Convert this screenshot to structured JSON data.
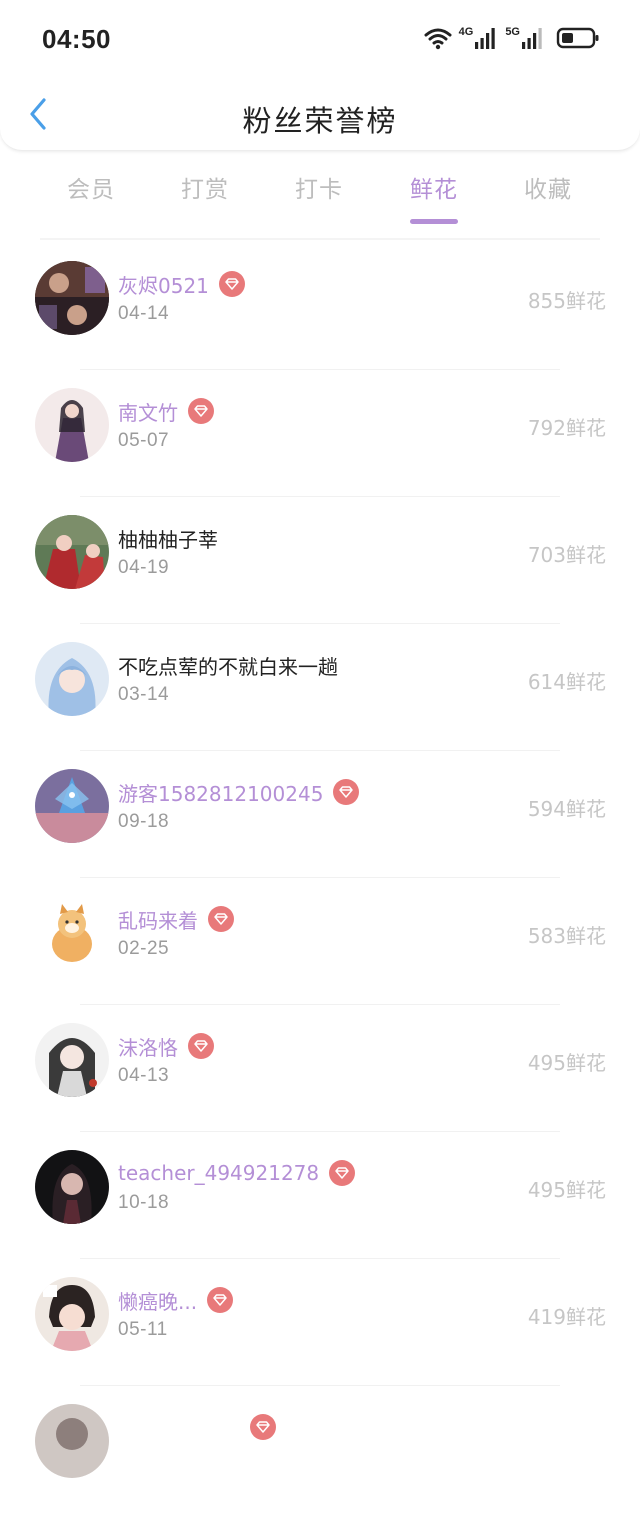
{
  "status_bar": {
    "time": "04:50",
    "wifi_icon": "wifi-icon",
    "sim1_label": "4G",
    "sim2_label": "5G",
    "battery_icon": "battery-icon"
  },
  "header": {
    "back_icon": "chevron-left-icon",
    "title": "粉丝荣誉榜"
  },
  "tabs": [
    {
      "label": "会员"
    },
    {
      "label": "打赏"
    },
    {
      "label": "打卡"
    },
    {
      "label": "鲜花"
    },
    {
      "label": "收藏"
    }
  ],
  "active_tab": "鲜花",
  "colors": {
    "accent": "#b48fd6",
    "badge": "#e8797a",
    "back_arrow": "#4a9fe8"
  },
  "fans": [
    {
      "name": "灰烬0521",
      "date": "04-14",
      "count": "855鲜花",
      "vip": true
    },
    {
      "name": "南文竹",
      "date": "05-07",
      "count": "792鲜花",
      "vip": true
    },
    {
      "name": "柚柚柚子莘",
      "date": "04-19",
      "count": "703鲜花",
      "vip": false
    },
    {
      "name": "不吃点荤的不就白来一趟",
      "date": "03-14",
      "count": "614鲜花",
      "vip": false
    },
    {
      "name": "游客1582812100245",
      "date": "09-18",
      "count": "594鲜花",
      "vip": true
    },
    {
      "name": "乱码来着",
      "date": "02-25",
      "count": "583鲜花",
      "vip": true
    },
    {
      "name": "沫洛恪",
      "date": "04-13",
      "count": "495鲜花",
      "vip": true
    },
    {
      "name": "teacher_494921278",
      "date": "10-18",
      "count": "495鲜花",
      "vip": true
    },
    {
      "name": "懒癌晚...",
      "date": "05-11",
      "count": "419鲜花",
      "vip": true
    }
  ]
}
